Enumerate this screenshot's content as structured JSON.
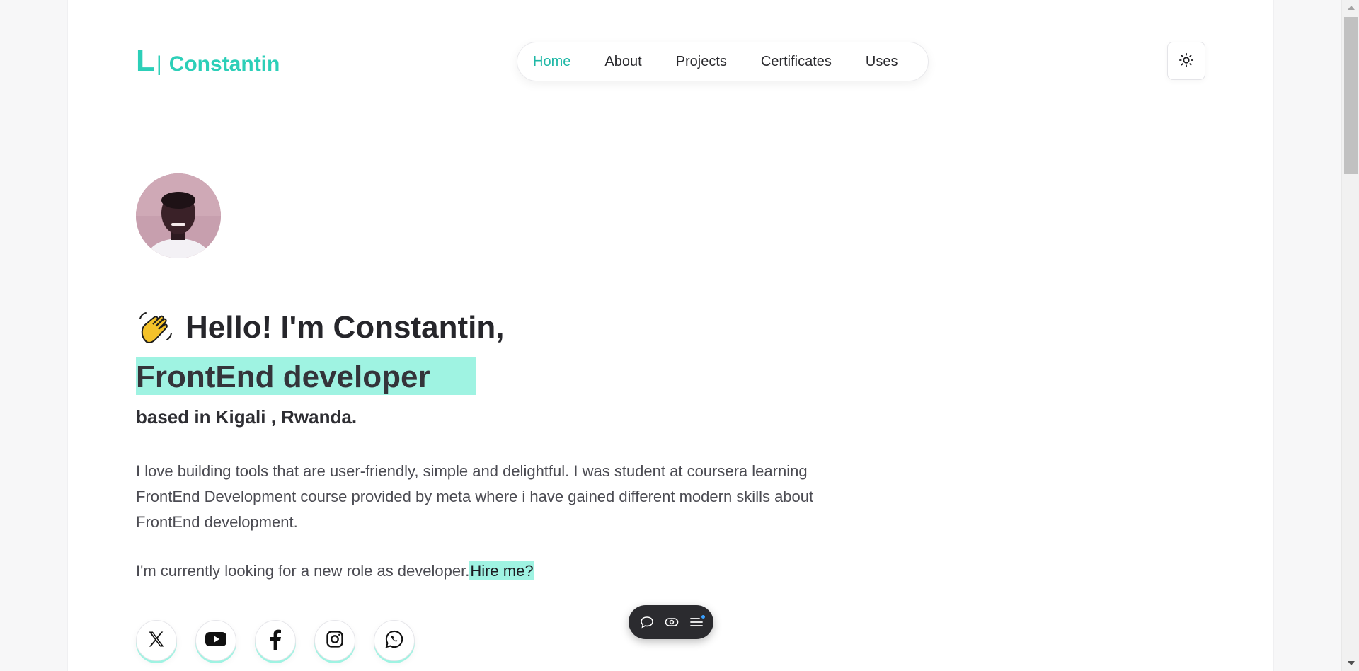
{
  "header": {
    "logo_mark": "L",
    "logo_bar": "|",
    "logo_name": "Constantin",
    "nav": [
      {
        "label": "Home",
        "active": true
      },
      {
        "label": "About",
        "active": false
      },
      {
        "label": "Projects",
        "active": false
      },
      {
        "label": "Certificates",
        "active": false
      },
      {
        "label": "Uses",
        "active": false
      }
    ],
    "theme_toggle_icon": "sun-icon"
  },
  "hero": {
    "avatar_icon": "profile-photo",
    "greeting_emoji": "waving-hand-icon",
    "greeting": "Hello! I'm Constantin,",
    "role": "FrontEnd developer",
    "location": "based in Kigali , Rwanda.",
    "bio": "I love building tools that are user-friendly, simple and delightful. I was student at coursera learning FrontEnd Development course provided by meta where i have gained different modern skills about FrontEnd development.",
    "looking": "I'm currently looking for a new role as developer.",
    "hire_link": "Hire me?"
  },
  "socials": [
    {
      "icon": "x-twitter-icon"
    },
    {
      "icon": "youtube-icon"
    },
    {
      "icon": "facebook-icon"
    },
    {
      "icon": "instagram-icon"
    },
    {
      "icon": "whatsapp-icon"
    }
  ],
  "floating_toolbar": {
    "icons": [
      "comment-icon",
      "eye-icon",
      "menu-icon"
    ]
  },
  "colors": {
    "accent": "#2ccfb8",
    "highlight": "#9ff3e2",
    "text": "#26262b"
  }
}
